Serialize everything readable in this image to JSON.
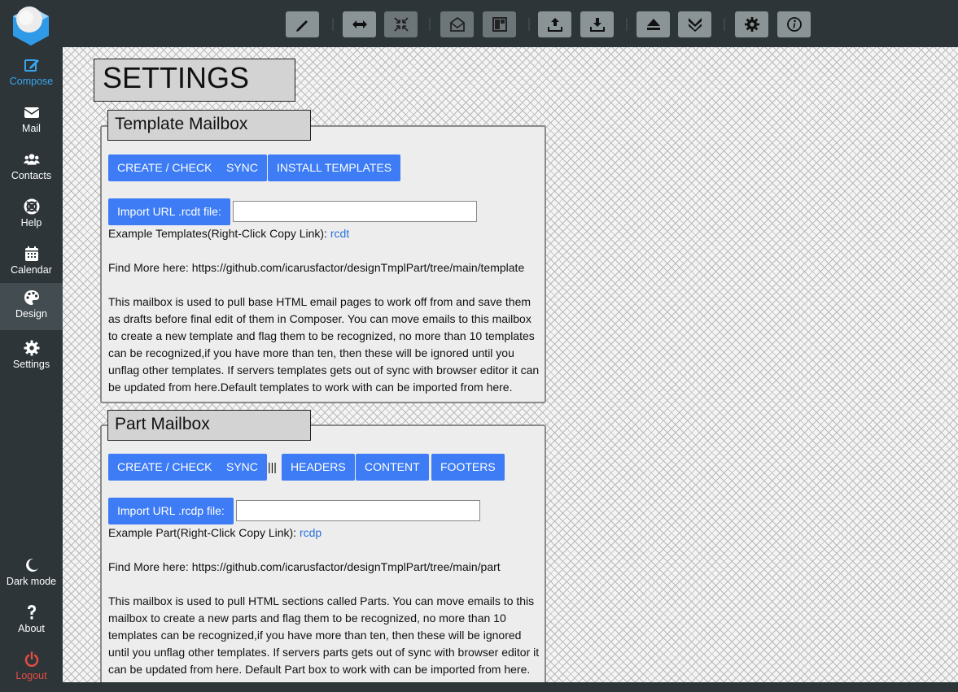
{
  "sidebar": {
    "items": [
      {
        "label": "Compose",
        "icon": "compose-icon"
      },
      {
        "label": "Mail",
        "icon": "envelope-icon"
      },
      {
        "label": "Contacts",
        "icon": "contacts-icon"
      },
      {
        "label": "Help",
        "icon": "lifebuoy-icon"
      },
      {
        "label": "Calendar",
        "icon": "calendar-icon"
      },
      {
        "label": "Design",
        "icon": "palette-icon"
      },
      {
        "label": "Settings",
        "icon": "gear-icon"
      }
    ],
    "bottom": [
      {
        "label": "Dark mode",
        "icon": "moon-icon"
      },
      {
        "label": "About",
        "icon": "question-icon"
      },
      {
        "label": "Logout",
        "icon": "power-icon"
      }
    ]
  },
  "toolbar": {
    "buttons": [
      "brush-icon",
      "expand-horizontal-icon",
      "compress-icon",
      "mail-open-icon",
      "layout-icon",
      "upload-icon",
      "download-icon",
      "eject-icon",
      "double-chevron-down-icon",
      "gear-icon",
      "info-icon"
    ]
  },
  "page": {
    "title": "SETTINGS"
  },
  "template_box": {
    "legend": "Template Mailbox",
    "buttons": [
      "CREATE / CHECK",
      "SYNC",
      "INSTALL TEMPLATES"
    ],
    "import_label": "Import URL .rcdt file:",
    "import_value": "",
    "example_text": "Example Templates(Right-Click Copy Link):",
    "example_link": "rcdt",
    "find_more": "Find More here: https://github.com/icarusfactor/designTmplPart/tree/main/template",
    "description": " This mailbox is used to pull base HTML email pages to work off from and save them as drafts before final edit of them in Composer. You can move emails to this mailbox to create a new template and flag them to be recognized, no more than 10 templates can be recognized,if you have more than ten, then these will be ignored until you unflag other templates. If servers templates gets out of sync with browser editor it can be updated from here.Default templates to work with can be imported from here."
  },
  "part_box": {
    "legend": "Part Mailbox",
    "buttons": [
      "CREATE / CHECK",
      "SYNC",
      "HEADERS",
      "CONTENT",
      "FOOTERS"
    ],
    "separator": "|||",
    "import_label": "Import URL .rcdp file:",
    "import_value": "",
    "example_text": "Example Part(Right-Click Copy Link):",
    "example_link": "rcdp",
    "find_more": "Find More here: https://github.com/icarusfactor/designTmplPart/tree/main/part",
    "description": " This mailbox is used to pull HTML sections called Parts. You can move emails to this mailbox to create a new parts and flag them to be recognized, no more than 10 templates can be recognized,if you have more than ten, then these will be ignored until you unflag other templates. If servers parts gets out of sync with browser editor it can be updated from here. Default Part box to work with can be imported from here."
  },
  "colors": {
    "sidebar_bg": "#2d3539",
    "accent_blue": "#3d7cf5",
    "compose_active": "#37a6f0",
    "logout_red": "#e84d44"
  }
}
